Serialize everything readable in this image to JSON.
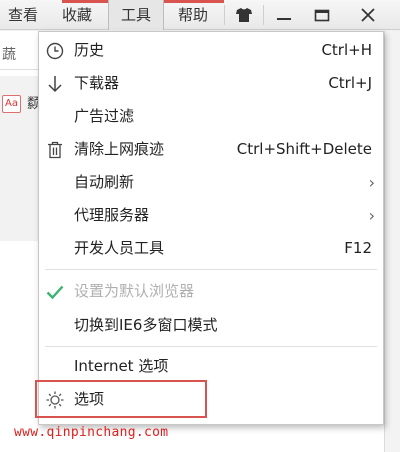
{
  "menubar": {
    "items": [
      "查看",
      "收藏",
      "工具",
      "帮助"
    ],
    "active": "工具"
  },
  "window_buttons": [
    "shirt-icon",
    "minimize-icon",
    "restore-icon",
    "close-icon"
  ],
  "background": {
    "address_fragment": "蔬",
    "aa_badge": "Aa",
    "side_char": "颣"
  },
  "tools_menu": {
    "items": [
      {
        "label": "历史",
        "shortcut": "Ctrl+H",
        "icon": "clock-icon"
      },
      {
        "label": "下载器",
        "shortcut": "Ctrl+J",
        "icon": "download-arrow-icon"
      },
      {
        "label": "广告过滤",
        "shortcut": "",
        "icon": ""
      },
      {
        "label": "清除上网痕迹",
        "shortcut": "Ctrl+Shift+Delete",
        "icon": "trash-icon"
      },
      {
        "label": "自动刷新",
        "shortcut": "",
        "submenu": true
      },
      {
        "label": "代理服务器",
        "shortcut": "",
        "submenu": true
      },
      {
        "label": "开发人员工具",
        "shortcut": "F12"
      },
      {
        "label": "设置为默认浏览器",
        "disabled": true,
        "icon": "checkmark-icon"
      },
      {
        "label": "切换到IE6多窗口模式"
      },
      {
        "label": "Internet 选项"
      },
      {
        "label": "选项",
        "icon": "settings-sun-icon",
        "highlighted": true
      }
    ]
  },
  "watermark": "www.qinpinchang.com",
  "colors": {
    "highlight_border": "#d9534f",
    "check_green": "#3cb371",
    "watermark_red": "#e0201e"
  }
}
